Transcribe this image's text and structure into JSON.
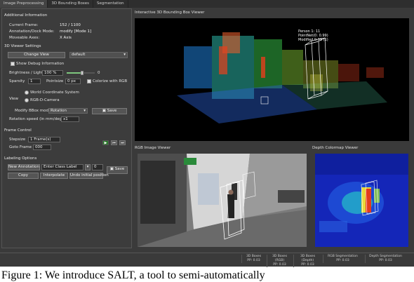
{
  "tabs": [
    {
      "label": "Image Preprocessing"
    },
    {
      "label": "3D Bounding Boxes"
    },
    {
      "label": "Segmentation"
    }
  ],
  "left": {
    "additional_info": {
      "title": "Additional Information",
      "current_frame_label": "Current Frame:",
      "current_frame_value": "152 / 1100",
      "annotation_mode_label": "Annotation/Dock Mode:",
      "annotation_mode_value": "modify [Mode 1]",
      "moveable_axes_label": "Moveable Axes:",
      "moveable_axes_value": "X Axis"
    },
    "viewer_settings": {
      "title": "3D Viewer Settings",
      "change_view_label": "Change View",
      "view_select_value": "default",
      "show_debug_label": "Show Debug Information",
      "brightness_label": "Brightness / Light",
      "brightness_value": "100 %",
      "brightness_end": "0",
      "brightness_fraction": 0.55,
      "sparsity_label": "Sparsity",
      "sparsity_value": "1",
      "pointsize_label": "Pointsize",
      "pointsize_value": "0 px",
      "colorize_label": "Colorize with RGB",
      "view_label": "View",
      "world_coord_label": "World Coordinate System",
      "rgbd_camera_label": "RGB-D-Camera",
      "modify_bbox_label": "Modify BBox mode",
      "modify_bbox_value": "Rotation",
      "save_label": "Save",
      "rotation_speed_label": "Rotation speed (in mm/deg):",
      "rotation_speed_value": "x1"
    },
    "frame_control": {
      "title": "Frame Control",
      "stepsize_label": "Stepsize",
      "stepsize_value": "1 Frame(s)",
      "goto_frame_label": "Goto Frame",
      "goto_frame_value": "000"
    },
    "labeling": {
      "title": "Labeling Options",
      "new_annotation_label": "New Annotation",
      "enter_class_placeholder": "Enter Class Label",
      "class_count_value": "0",
      "copy_label": "Copy",
      "interpolate_label": "Interpolate",
      "undo_redo_label": "Undo initial position",
      "save_label": "Save"
    }
  },
  "viewers": {
    "pointcloud_title": "Interactive 3D Bounding Box Viewer",
    "pointcloud_annotation": "Person 1: 11\nPointNet(0: 0.99)\nModified 0.99 (1)",
    "rgb_title": "RGB Image Viewer",
    "depth_title": "Depth Colormap Viewer"
  },
  "status_bar": [
    {
      "label": "3D Boxes\nPP: 0.03"
    },
    {
      "label": "3D Boxes (RGB)\nPP: 0.03"
    },
    {
      "label": "3D Boxes (Depth)\nPP: 0.03"
    },
    {
      "label": "RGB Segmentation\nPP: 0.03"
    },
    {
      "label": "Depth Segmentation\nPP: 0.03"
    }
  ],
  "caption": "Figure 1: We introduce SALT, a tool to semi-automatically",
  "colors": {
    "background": "#3a3a3a",
    "panel": "#3c3c3c",
    "accent_green": "#2b7a2b",
    "depth_blue": "#0a1aa8"
  }
}
